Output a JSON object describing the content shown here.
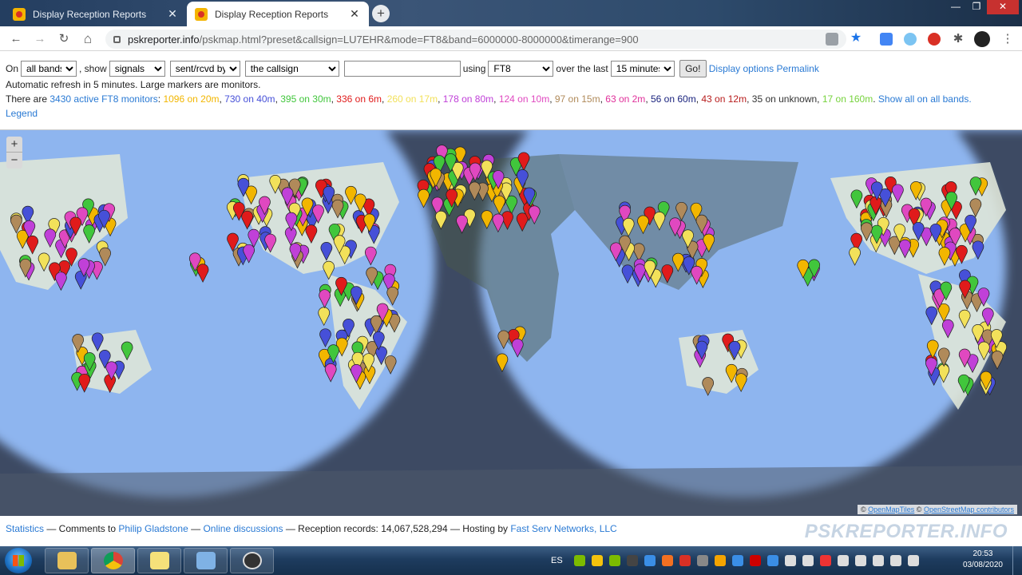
{
  "browser": {
    "tabs": [
      {
        "label": "Display Reception Reports",
        "close": "✕"
      },
      {
        "label": "Display Reception Reports",
        "close": "✕"
      }
    ],
    "new_tab": "+",
    "window_controls": {
      "minimize": "—",
      "maximize": "❐",
      "close": "✕"
    },
    "url_host": "pskreporter.info",
    "url_path": "/pskmap.html?preset&callsign=LU7EHR&mode=FT8&band=6000000-8000000&timerange=900",
    "nav": {
      "back": "←",
      "forward": "→",
      "reload": "↻",
      "home": "⌂"
    }
  },
  "controls": {
    "on_label": "On",
    "band_value": "all bands",
    "show_label": ", show",
    "show_value": "signals",
    "direction_value": "sent/rcvd by",
    "target_value": "the callsign",
    "callsign_value": "",
    "using_label": "using",
    "mode_value": "FT8",
    "over_label": "over the last",
    "time_value": "15 minutes",
    "go_label": "Go!",
    "display_options": "Display options",
    "permalink": "Permalink"
  },
  "status": {
    "refresh_text": "Automatic refresh in 5 minutes. Large markers are monitors.",
    "monitors_prefix": "There are ",
    "monitors_link": "3430 active FT8 monitors",
    "bands": [
      {
        "text": "1096 on 20m",
        "color": "#f2b600"
      },
      {
        "text": "730 on 40m",
        "color": "#4650d8"
      },
      {
        "text": "395 on 30m",
        "color": "#41c63c"
      },
      {
        "text": "336 on 6m",
        "color": "#e01b1b"
      },
      {
        "text": "260 on 17m",
        "color": "#f2e15a"
      },
      {
        "text": "178 on 80m",
        "color": "#c040d8"
      },
      {
        "text": "124 on 10m",
        "color": "#e048c0"
      },
      {
        "text": "97 on 15m",
        "color": "#b08a5a"
      },
      {
        "text": "63 on 2m",
        "color": "#e0309a"
      },
      {
        "text": "56 on 60m",
        "color": "#1a237e"
      },
      {
        "text": "43 on 12m",
        "color": "#b71c1c"
      },
      {
        "text": "35 on unknown",
        "color": "#333333"
      },
      {
        "text": "17 on 160m",
        "color": "#76d23c"
      }
    ],
    "show_all": "Show all on all bands.",
    "legend": "Legend"
  },
  "map": {
    "zoom_in": "+",
    "zoom_out": "−",
    "attribution_prefix": "© ",
    "attribution_tiles": "OpenMapTiles",
    "attribution_sep": " © ",
    "attribution_osm": "OpenStreetMap contributors"
  },
  "footer": {
    "statistics": "Statistics",
    "comments_prefix": " — Comments to ",
    "author": "Philip Gladstone",
    "sep1": " — ",
    "discussions": "Online discussions",
    "records_text": " — Reception records: 14,067,528,294 — Hosting by ",
    "host": "Fast Serv Networks, LLC",
    "brand": "PSKREPORTER.INFO"
  },
  "taskbar": {
    "lang": "ES",
    "time": "20:53",
    "date": "03/08/2020"
  }
}
